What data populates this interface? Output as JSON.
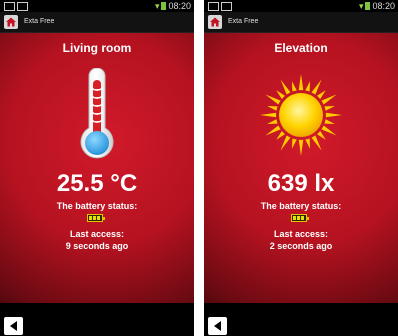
{
  "status_bar": {
    "time": "08:20"
  },
  "screens": [
    {
      "app_name": "Exta Free",
      "title": "Living room",
      "icon": "thermometer-icon",
      "value": "25.5 °C",
      "battery_label": "The battery status:",
      "battery_icon": "battery-icon",
      "access_label": "Last access:",
      "access_value": "9 seconds ago"
    },
    {
      "app_name": "Exta Free",
      "title": "Elevation",
      "icon": "sun-icon",
      "value": "639 lx",
      "battery_label": "The battery status:",
      "battery_icon": "battery-icon",
      "access_label": "Last access:",
      "access_value": "2 seconds ago"
    }
  ],
  "colors": {
    "background_red": "#c41424",
    "battery_yellow": "#e8e000",
    "status_green": "#7fc241"
  }
}
